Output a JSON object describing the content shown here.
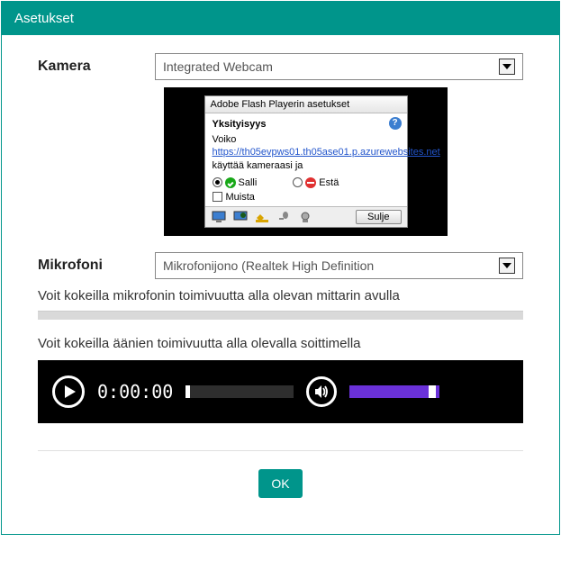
{
  "header": {
    "title": "Asetukset"
  },
  "camera": {
    "label": "Kamera",
    "value": "Integrated Webcam"
  },
  "flash": {
    "title": "Adobe Flash Playerin asetukset",
    "privacy_heading": "Yksityisyys",
    "msg_before": "Voiko ",
    "url": "https://th05evpws01.th05ase01.p.azurewebsites.net",
    "msg_after": " käyttää kameraasi ja",
    "allow": "Salli",
    "deny": "Estä",
    "remember": "Muista",
    "close": "Sulje"
  },
  "mic": {
    "label": "Mikrofoni",
    "value": "Mikrofonijono (Realtek High Definition",
    "test_text": "Voit kokeilla mikrofonin toimivuutta alla olevan mittarin avulla"
  },
  "sound": {
    "test_text": "Voit kokeilla äänien toimivuutta alla olevalla soittimella",
    "time": "0:00:00"
  },
  "footer": {
    "ok": "OK"
  }
}
